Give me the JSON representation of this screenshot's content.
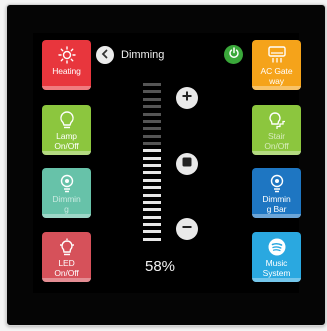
{
  "header": {
    "title": "Dimming"
  },
  "tiles_left": [
    {
      "label": "Heating",
      "color": "#e8363d",
      "icon": "sun-icon",
      "dim": false
    },
    {
      "label": "Lamp\nOn/Off",
      "color": "#8cc63e",
      "icon": "bulb-icon",
      "dim": false
    },
    {
      "label": "Dimmin\ng",
      "color": "#67c2a9",
      "icon": "dimming-bulb-icon",
      "dim": true
    },
    {
      "label": "LED\nOn/Off",
      "color": "#d6515a",
      "icon": "led-icon",
      "dim": false
    }
  ],
  "tiles_right": [
    {
      "label": "AC Gate\nway",
      "color": "#f5a31a",
      "icon": "ac-icon",
      "dim": false
    },
    {
      "label": "Stair\nOn/Off",
      "color": "#8cc63e",
      "icon": "stair-light-icon",
      "dim": true
    },
    {
      "label": "Dimmin\ng Bar",
      "color": "#1e76c2",
      "icon": "dimming-bar-icon",
      "dim": false
    },
    {
      "label": "Music\nSystem",
      "color": "#2aa8e0",
      "icon": "music-icon",
      "dim": false
    }
  ],
  "dimmer": {
    "level_percent": 58,
    "level_label": "58%",
    "segments": 22
  },
  "colors": {
    "power": "#3aa83a",
    "segment_on": "#e8e8e8",
    "segment_off": "#555555"
  }
}
